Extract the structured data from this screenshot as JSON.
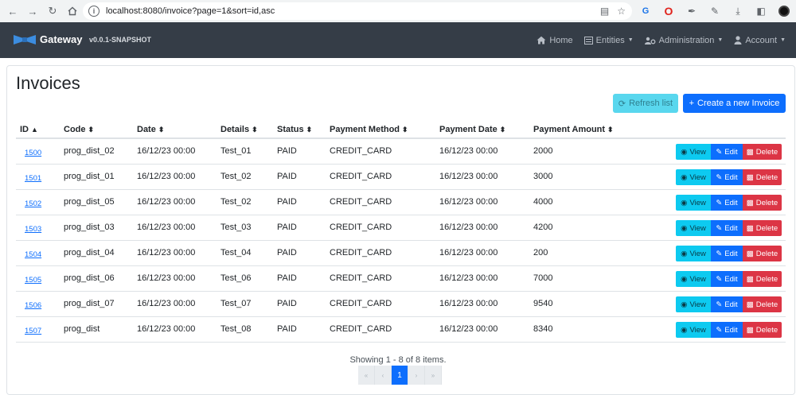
{
  "browser": {
    "url": "localhost:8080/invoice?page=1&sort=id,asc"
  },
  "navbar": {
    "brand": "Gateway",
    "version": "v0.0.1-SNAPSHOT",
    "items": [
      {
        "label": "Home",
        "icon": "home-icon"
      },
      {
        "label": "Entities",
        "icon": "list-icon"
      },
      {
        "label": "Administration",
        "icon": "users-cog-icon"
      },
      {
        "label": "Account",
        "icon": "user-icon"
      }
    ]
  },
  "page": {
    "title": "Invoices",
    "refresh_label": "Refresh list",
    "create_label": "Create a new Invoice"
  },
  "table": {
    "headers": [
      "ID",
      "Code",
      "Date",
      "Details",
      "Status",
      "Payment Method",
      "Payment Date",
      "Payment Amount"
    ],
    "rows": [
      {
        "id": "1500",
        "code": "prog_dist_02",
        "date": "16/12/23 00:00",
        "details": "Test_01",
        "status": "PAID",
        "method": "CREDIT_CARD",
        "pdate": "16/12/23 00:00",
        "amount": "2000"
      },
      {
        "id": "1501",
        "code": "prog_dist_01",
        "date": "16/12/23 00:00",
        "details": "Test_02",
        "status": "PAID",
        "method": "CREDIT_CARD",
        "pdate": "16/12/23 00:00",
        "amount": "3000"
      },
      {
        "id": "1502",
        "code": "prog_dist_05",
        "date": "16/12/23 00:00",
        "details": "Test_02",
        "status": "PAID",
        "method": "CREDIT_CARD",
        "pdate": "16/12/23 00:00",
        "amount": "4000"
      },
      {
        "id": "1503",
        "code": "prog_dist_03",
        "date": "16/12/23 00:00",
        "details": "Test_03",
        "status": "PAID",
        "method": "CREDIT_CARD",
        "pdate": "16/12/23 00:00",
        "amount": "4200"
      },
      {
        "id": "1504",
        "code": "prog_dist_04",
        "date": "16/12/23 00:00",
        "details": "Test_04",
        "status": "PAID",
        "method": "CREDIT_CARD",
        "pdate": "16/12/23 00:00",
        "amount": "200"
      },
      {
        "id": "1505",
        "code": "prog_dist_06",
        "date": "16/12/23 00:00",
        "details": "Test_06",
        "status": "PAID",
        "method": "CREDIT_CARD",
        "pdate": "16/12/23 00:00",
        "amount": "7000"
      },
      {
        "id": "1506",
        "code": "prog_dist_07",
        "date": "16/12/23 00:00",
        "details": "Test_07",
        "status": "PAID",
        "method": "CREDIT_CARD",
        "pdate": "16/12/23 00:00",
        "amount": "9540"
      },
      {
        "id": "1507",
        "code": "prog_dist",
        "date": "16/12/23 00:00",
        "details": "Test_08",
        "status": "PAID",
        "method": "CREDIT_CARD",
        "pdate": "16/12/23 00:00",
        "amount": "8340"
      }
    ],
    "actions": {
      "view": "View",
      "edit": "Edit",
      "delete": "Delete"
    }
  },
  "pagination": {
    "showing": "Showing 1 - 8 of 8 items.",
    "first": "«",
    "prev": "‹",
    "current": "1",
    "next": "›",
    "last": "»"
  },
  "colors": {
    "navbar": "#353d47",
    "primary": "#0d6efd",
    "info": "#0dcaf0",
    "danger": "#dc3545"
  }
}
